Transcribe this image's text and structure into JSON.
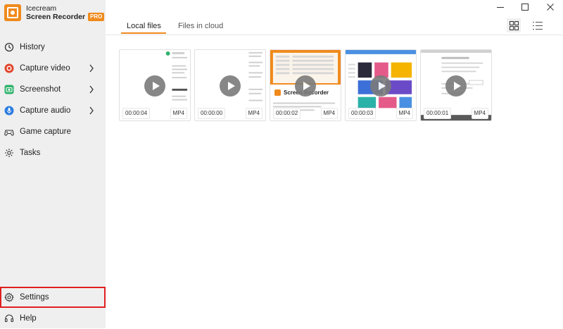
{
  "app": {
    "name_line1": "Icecream",
    "name_line2": "Screen Recorder",
    "badge": "PRO",
    "accent": "#f08a1c"
  },
  "sidebar": {
    "items": [
      {
        "label": "History",
        "icon": "history-icon"
      },
      {
        "label": "Capture video",
        "icon": "record-icon"
      },
      {
        "label": "Screenshot",
        "icon": "camera-icon"
      },
      {
        "label": "Capture audio",
        "icon": "microphone-icon"
      },
      {
        "label": "Game capture",
        "icon": "gamepad-icon"
      },
      {
        "label": "Tasks",
        "icon": "tasks-icon"
      }
    ],
    "bottom": [
      {
        "label": "Settings",
        "icon": "gear-icon"
      },
      {
        "label": "Help",
        "icon": "help-icon"
      }
    ]
  },
  "tabs": [
    {
      "label": "Local files"
    },
    {
      "label": "Files in cloud"
    }
  ],
  "files": [
    {
      "duration": "00:00:04",
      "format": "MP4",
      "variant": "doc"
    },
    {
      "duration": "00:00:00",
      "format": "MP4",
      "variant": "doc2"
    },
    {
      "duration": "00:00:02",
      "format": "MP4",
      "variant": "recorder",
      "thumb_title": "Screen Recorder"
    },
    {
      "duration": "00:00:03",
      "format": "MP4",
      "variant": "apps"
    },
    {
      "duration": "00:00:01",
      "format": "MP4",
      "variant": "form"
    }
  ]
}
